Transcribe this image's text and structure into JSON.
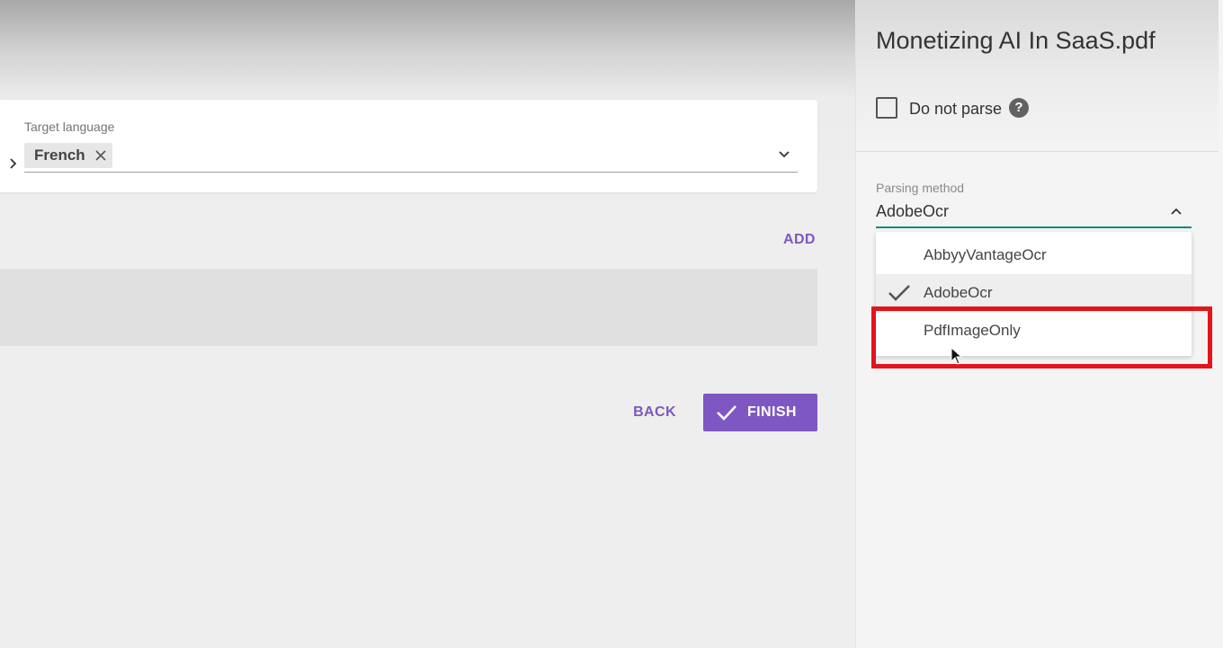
{
  "main": {
    "target_language": {
      "label": "Target language",
      "chip": "French"
    },
    "add_label": "ADD",
    "back_label": "BACK",
    "finish_label": "FINISH"
  },
  "panel": {
    "file_title": "Monetizing AI In SaaS.pdf",
    "do_not_parse": {
      "label": "Do not parse",
      "checked": false,
      "help": "?"
    },
    "parsing_method": {
      "label": "Parsing method",
      "value": "AdobeOcr",
      "options": [
        {
          "label": "AbbyyVantageOcr",
          "selected": false
        },
        {
          "label": "AdobeOcr",
          "selected": true
        },
        {
          "label": "PdfImageOnly",
          "selected": false,
          "highlighted": true
        }
      ]
    }
  },
  "colors": {
    "accent": "#7e57c2",
    "focus_underline": "#00897b",
    "highlight": "#e4141b"
  }
}
